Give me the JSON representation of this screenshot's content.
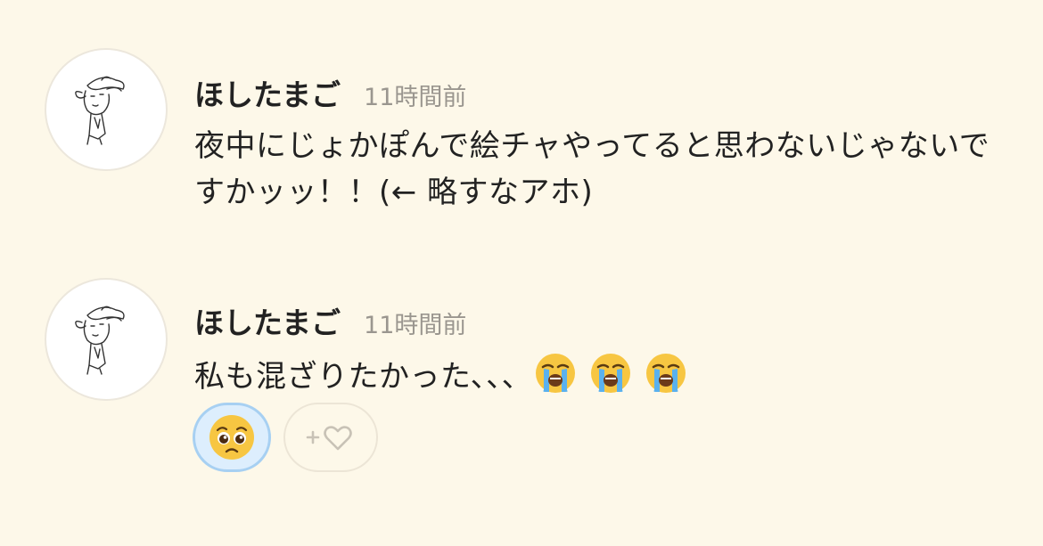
{
  "comments": [
    {
      "username": "ほしたまご",
      "timestamp": "11時間前",
      "text": "夜中にじょかぽんで絵チャやってると思わないじゃないですかッッ！！(← 略すなアホ)"
    },
    {
      "username": "ほしたまご",
      "timestamp": "11時間前",
      "text": "私も混ざりたかった､､､",
      "emojis": [
        "loudly-crying-face",
        "loudly-crying-face",
        "loudly-crying-face"
      ],
      "reactions": [
        {
          "emoji": "pleading-face",
          "active": true
        },
        {
          "type": "add-reaction",
          "icon": "plus-heart-icon"
        }
      ]
    }
  ],
  "colors": {
    "background": "#fdf8e9",
    "timestamp": "#9a968f",
    "reaction_active_bg": "#ddeefd",
    "reaction_active_border": "#a7d0f2"
  }
}
